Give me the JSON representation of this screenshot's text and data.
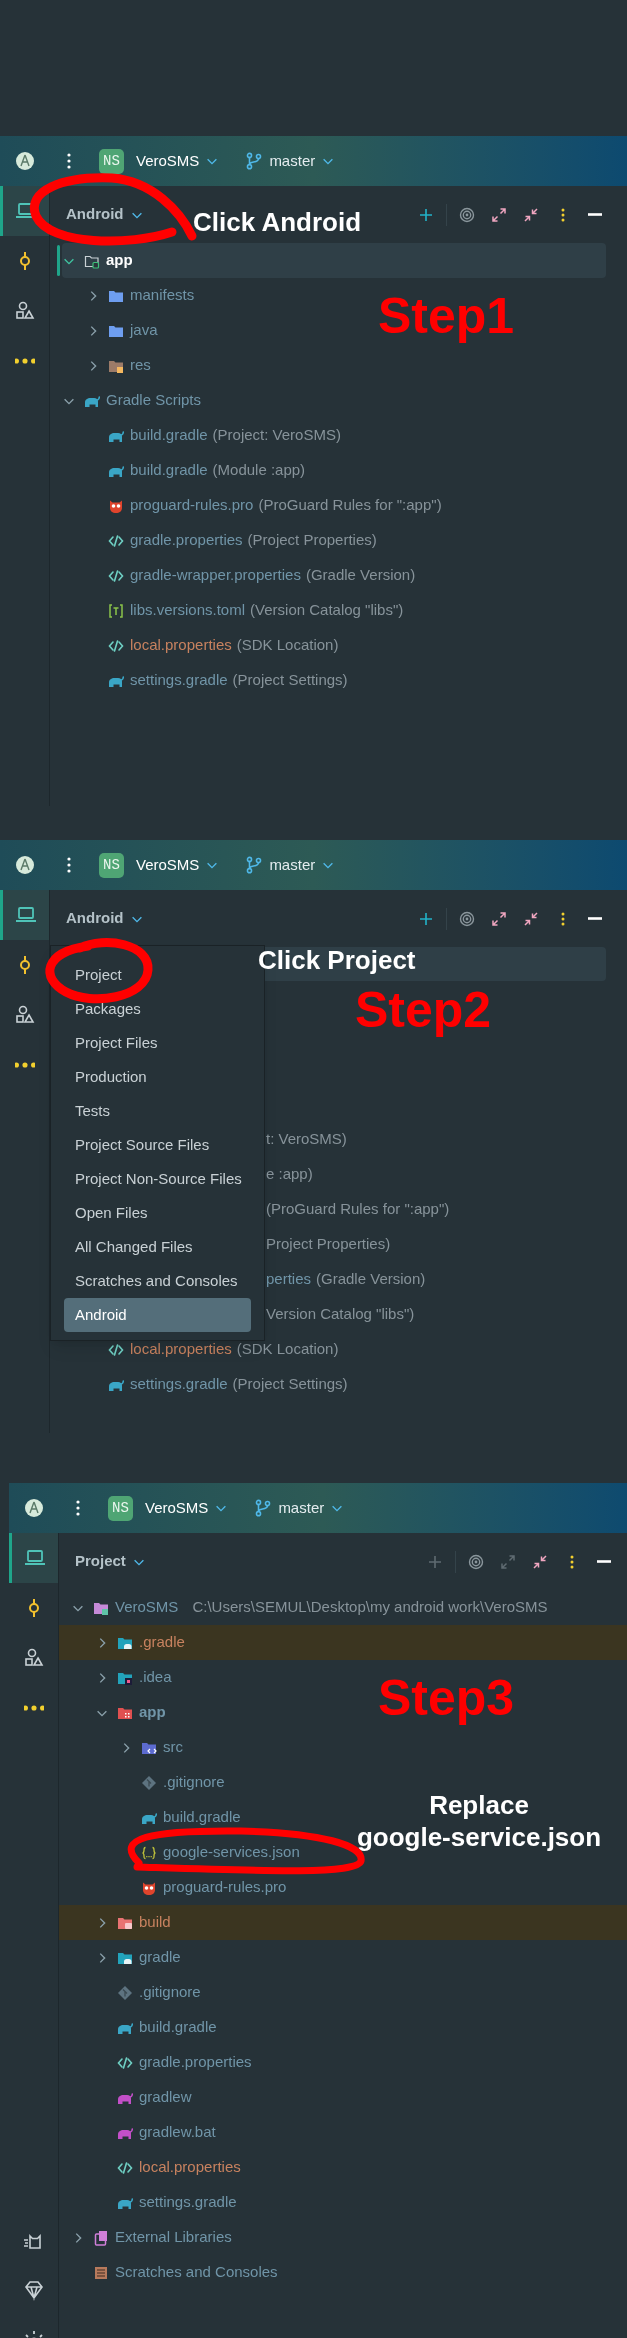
{
  "panels": [
    {
      "header": {
        "project_badge": "NS",
        "project": "VeroSMS",
        "branch": "master"
      },
      "sidebar": {
        "top": [
          {
            "kind": "project",
            "selected": true
          },
          {
            "kind": "commit",
            "selected": false
          },
          {
            "kind": "resources",
            "selected": false
          },
          {
            "kind": "more",
            "selected": false
          }
        ]
      },
      "view_selector": "Android",
      "toolbar": [
        {
          "kind": "add",
          "disabled": false
        },
        {
          "kind": "locate",
          "disabled": false
        },
        {
          "kind": "expand",
          "disabled": false
        },
        {
          "kind": "collapse",
          "disabled": false
        },
        {
          "kind": "options",
          "disabled": false
        },
        {
          "kind": "hide",
          "disabled": false
        }
      ],
      "tree": [
        {
          "label": "app",
          "kind": "module-folder",
          "expanded": true,
          "selected": true,
          "ignored": false,
          "children": [
            {
              "label": "manifests",
              "kind": "folder",
              "expanded": false,
              "selected": false,
              "ignored": false
            },
            {
              "label": "java",
              "kind": "folder",
              "expanded": false,
              "selected": false,
              "ignored": false
            },
            {
              "label": "res",
              "kind": "folder-res",
              "expanded": false,
              "selected": false,
              "ignored": false
            }
          ]
        },
        {
          "label": "Gradle Scripts",
          "kind": "gradle",
          "expanded": true,
          "selected": false,
          "ignored": false,
          "children": [
            {
              "label": "build.gradle",
              "detail": "(Project: VeroSMS)",
              "kind": "gradle",
              "selected": false,
              "ignored": false
            },
            {
              "label": "build.gradle",
              "detail": "(Module :app)",
              "kind": "gradle",
              "selected": false,
              "ignored": false
            },
            {
              "label": "proguard-rules.pro",
              "detail": "(ProGuard Rules for \":app\")",
              "kind": "proguard",
              "selected": false,
              "ignored": false
            },
            {
              "label": "gradle.properties",
              "detail": "(Project Properties)",
              "kind": "properties",
              "selected": false,
              "ignored": false
            },
            {
              "label": "gradle-wrapper.properties",
              "detail": "(Gradle Version)",
              "kind": "properties",
              "selected": false,
              "ignored": false
            },
            {
              "label": "libs.versions.toml",
              "detail": "(Version Catalog \"libs\")",
              "kind": "toml",
              "selected": false,
              "ignored": false
            },
            {
              "label": "local.properties",
              "detail": "(SDK Location)",
              "kind": "properties",
              "selected": false,
              "ignored": true
            },
            {
              "label": "settings.gradle",
              "detail": "(Project Settings)",
              "kind": "gradle",
              "selected": false,
              "ignored": false
            }
          ]
        }
      ],
      "annotations": [
        {
          "kind": "circle"
        },
        {
          "kind": "callout",
          "text": "Click Android"
        },
        {
          "kind": "step",
          "text": "Step1"
        }
      ]
    },
    {
      "header": {
        "project_badge": "NS",
        "project": "VeroSMS",
        "branch": "master"
      },
      "sidebar": {
        "top": [
          {
            "kind": "project",
            "selected": true
          },
          {
            "kind": "commit",
            "selected": false
          },
          {
            "kind": "resources",
            "selected": false
          },
          {
            "kind": "more",
            "selected": false
          }
        ]
      },
      "view_selector": "Android",
      "toolbar": [
        {
          "kind": "add",
          "disabled": false
        },
        {
          "kind": "locate",
          "disabled": false
        },
        {
          "kind": "expand",
          "disabled": false
        },
        {
          "kind": "collapse",
          "disabled": false
        },
        {
          "kind": "options",
          "disabled": false
        },
        {
          "kind": "hide",
          "disabled": false
        }
      ],
      "tree_partial": {
        "selected_row": true,
        "rows": [
          {
            "detail": "t: VeroSMS)"
          },
          {
            "detail": "e :app)"
          },
          {
            "detail": "(ProGuard Rules for \":app\")"
          },
          {
            "detail": "Project Properties)"
          },
          {
            "label": "perties",
            "detail": "(Gradle Version)"
          },
          {
            "detail": "Version Catalog \"libs\")"
          }
        ]
      },
      "tree_indent": [
        {
          "label": "local.properties",
          "detail": "(SDK Location)",
          "kind": "properties",
          "selected": false,
          "ignored": true
        },
        {
          "label": "settings.gradle",
          "detail": "(Project Settings)",
          "kind": "gradle",
          "selected": false,
          "ignored": false
        }
      ],
      "view_menu": [
        {
          "label": "Project",
          "selected": false
        },
        {
          "label": "Packages",
          "selected": false
        },
        {
          "label": "Project Files",
          "selected": false
        },
        {
          "label": "Production",
          "selected": false
        },
        {
          "label": "Tests",
          "selected": false
        },
        {
          "label": "Project Source Files",
          "selected": false
        },
        {
          "label": "Project Non-Source Files",
          "selected": false
        },
        {
          "label": "Open Files",
          "selected": false
        },
        {
          "label": "All Changed Files",
          "selected": false
        },
        {
          "label": "Scratches and Consoles",
          "selected": false
        },
        {
          "label": "Android",
          "selected": true
        }
      ],
      "annotations": [
        {
          "kind": "circle"
        },
        {
          "kind": "callout",
          "text": "Click Project"
        },
        {
          "kind": "step",
          "text": "Step2"
        }
      ]
    },
    {
      "header": {
        "project_badge": "NS",
        "project": "VeroSMS",
        "branch": "master"
      },
      "sidebar": {
        "top": [
          {
            "kind": "project",
            "selected": true
          },
          {
            "kind": "commit",
            "selected": false
          },
          {
            "kind": "resources",
            "selected": false
          },
          {
            "kind": "more",
            "selected": false
          }
        ],
        "bottom": [
          {
            "kind": "cat",
            "selected": false
          },
          {
            "kind": "gem",
            "selected": false
          },
          {
            "kind": "sun",
            "selected": false
          }
        ]
      },
      "view_selector": "Project",
      "toolbar": [
        {
          "kind": "add",
          "disabled": true
        },
        {
          "kind": "locate",
          "disabled": false
        },
        {
          "kind": "expand",
          "disabled": true
        },
        {
          "kind": "collapse",
          "disabled": false
        },
        {
          "kind": "options",
          "disabled": false
        },
        {
          "kind": "hide",
          "disabled": false
        }
      ],
      "tree": [
        {
          "label": "VeroSMS",
          "detail": "C:\\Users\\SEMUL\\Desktop\\my android work\\VeroSMS",
          "kind": "folder-root",
          "expanded": true,
          "selected": false,
          "ignored": false,
          "children": [
            {
              "label": ".gradle",
              "kind": "folder-gradle",
              "expanded": false,
              "selected": false,
              "ignored": true
            },
            {
              "label": ".idea",
              "kind": "folder-idea",
              "expanded": false,
              "selected": false,
              "ignored": false
            },
            {
              "label": "app",
              "kind": "module-red",
              "expanded": true,
              "selected": false,
              "ignored": false,
              "children": [
                {
                  "label": "src",
                  "kind": "folder-src",
                  "expanded": false,
                  "selected": false,
                  "ignored": false
                },
                {
                  "label": ".gitignore",
                  "kind": "git",
                  "selected": false,
                  "ignored": false
                },
                {
                  "label": "build.gradle",
                  "kind": "gradle",
                  "selected": false,
                  "ignored": false
                },
                {
                  "label": "google-services.json",
                  "kind": "json",
                  "selected": false,
                  "ignored": false
                },
                {
                  "label": "proguard-rules.pro",
                  "kind": "proguard",
                  "selected": false,
                  "ignored": false
                }
              ]
            },
            {
              "label": "build",
              "kind": "folder-build",
              "expanded": false,
              "selected": false,
              "ignored": true
            },
            {
              "label": "gradle",
              "kind": "folder-gradle",
              "expanded": false,
              "selected": false,
              "ignored": false
            },
            {
              "label": ".gitignore",
              "kind": "git",
              "selected": false,
              "ignored": false
            },
            {
              "label": "build.gradle",
              "kind": "gradle",
              "selected": false,
              "ignored": false
            },
            {
              "label": "gradle.properties",
              "kind": "properties",
              "selected": false,
              "ignored": false
            },
            {
              "label": "gradlew",
              "kind": "gradlew",
              "selected": false,
              "ignored": false
            },
            {
              "label": "gradlew.bat",
              "kind": "gradlew",
              "selected": false,
              "ignored": false
            },
            {
              "label": "local.properties",
              "kind": "properties",
              "selected": false,
              "ignored": true
            },
            {
              "label": "settings.gradle",
              "kind": "gradle",
              "selected": false,
              "ignored": false
            }
          ]
        },
        {
          "label": "External Libraries",
          "kind": "libraries",
          "expanded": false,
          "selected": false,
          "ignored": false
        },
        {
          "label": "Scratches and Consoles",
          "kind": "scratches",
          "selected": false,
          "ignored": false
        }
      ],
      "annotations": [
        {
          "kind": "step",
          "text": "Step3"
        },
        {
          "kind": "callout",
          "text": "Replace\ngoogle-service.json"
        },
        {
          "kind": "circle"
        }
      ]
    }
  ]
}
